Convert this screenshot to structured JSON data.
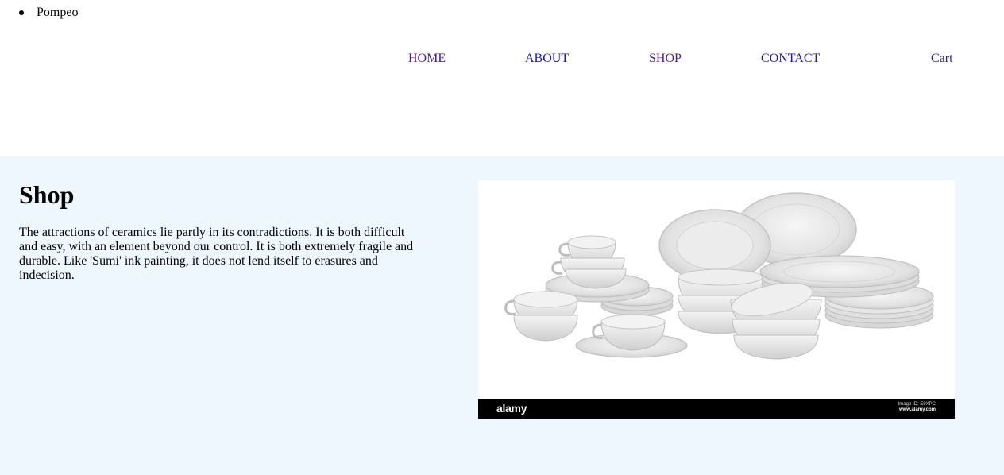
{
  "brand": {
    "name": "Pompeo"
  },
  "nav": {
    "items": [
      {
        "label": "HOME"
      },
      {
        "label": "ABOUT"
      },
      {
        "label": "SHOP"
      },
      {
        "label": "CONTACT"
      }
    ],
    "cart_label": "Cart"
  },
  "shop": {
    "title": "Shop",
    "description": "The attractions of ceramics lie partly in its contradictions. It is both difficult and easy, with an element beyond our control. It is both extremely fragile and durable. Like 'Sumi' ink painting, it does not lend itself to erasures and indecision."
  },
  "image": {
    "watermark_brand": "alamy",
    "image_id": "Image ID: E9XPC",
    "watermark_url": "www.alamy.com"
  },
  "colors": {
    "section_background": "#eef6fe",
    "visited_link": "#4b1c7a",
    "link": "#1d1aa8"
  }
}
